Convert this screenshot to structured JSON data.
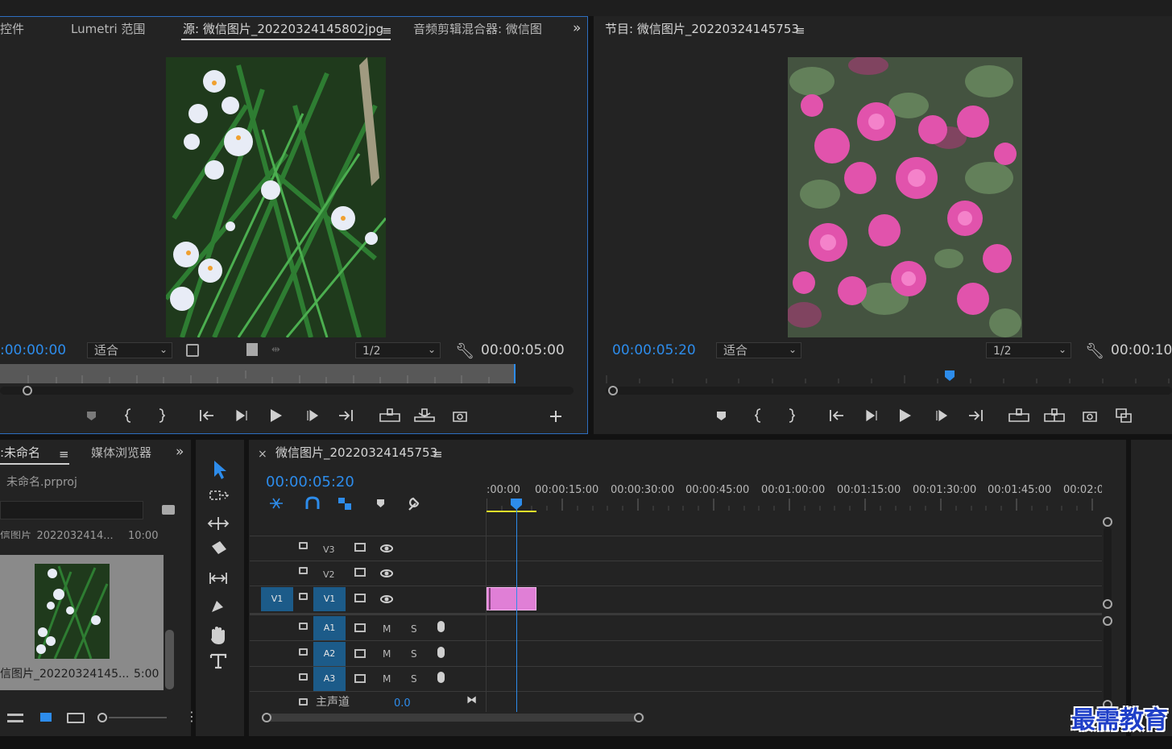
{
  "source_monitor": {
    "tabs": [
      "效果控件",
      "Lumetri 范围",
      "源: 微信图片_20220324145802jpg",
      "音频剪辑混合器: 微信图"
    ],
    "tab_left_partial": "控件",
    "active_tab": "源: 微信图片_20220324145802jpg",
    "menu_icon": "hamburger-icon",
    "overflow_icon": "double-chevron-icon",
    "timecode_current": "00:00:00",
    "fit_select": "适合",
    "resolution_select": "1/2",
    "timecode_duration": "00:00:05:00",
    "controls": [
      "marker",
      "in-point",
      "out-point",
      "go-to-in",
      "step-back",
      "play",
      "step-forward",
      "go-to-out",
      "insert",
      "overwrite",
      "export-frame",
      "add"
    ]
  },
  "program_monitor": {
    "title": "节目: 微信图片_20220324145753",
    "timecode_current": "00:00:05:20",
    "fit_select": "适合",
    "resolution_select": "1/2",
    "timecode_duration": "00:00:10:",
    "controls": [
      "marker",
      "in-point",
      "out-point",
      "go-to-in",
      "step-back",
      "play",
      "step-forward",
      "go-to-out",
      "lift",
      "extract",
      "export-frame",
      "compare"
    ]
  },
  "project_panel": {
    "tab_project": "目: 未命名",
    "tab_project_partial": ":未命名",
    "tab_media": "媒体浏览器",
    "tab_media_partial": "媒体浏览器",
    "file_name": "未命名.prproj",
    "item_top_name": "信图片_2022032414...",
    "item_top_duration": "10:00",
    "item_name": "信图片_20220324145...",
    "item_duration": "5:00"
  },
  "timeline": {
    "close": "×",
    "sequence_name": "微信图片_20220324145753",
    "timecode": "00:00:05:20",
    "ruler": [
      ":00:00",
      "00:00:15:00",
      "00:00:30:00",
      "00:00:45:00",
      "00:01:00:00",
      "00:01:15:00",
      "00:01:30:00",
      "00:01:45:00",
      "00:02:0"
    ],
    "video_tracks": [
      {
        "src": "",
        "name": "V3"
      },
      {
        "src": "",
        "name": "V2"
      },
      {
        "src": "V1",
        "name": "V1"
      }
    ],
    "audio_tracks": [
      {
        "name": "A1",
        "m": "M",
        "s": "S"
      },
      {
        "name": "A2",
        "m": "M",
        "s": "S"
      },
      {
        "name": "A3",
        "m": "M",
        "s": "S"
      }
    ],
    "master_label": "主声道",
    "master_value": "0.0",
    "clip_color": "#e07fd6"
  },
  "tools": [
    "selection-tool",
    "track-select-tool",
    "ripple-edit-tool",
    "razor-tool",
    "slip-tool",
    "pen-tool",
    "hand-tool",
    "type-tool"
  ],
  "watermark": "最需教育",
  "colors": {
    "accent": "#2d8ceb",
    "panel": "#232323",
    "bg": "#121212",
    "track_blue": "#1c5b89",
    "clip": "#e07fd6",
    "playhead": "#2d8ceb",
    "work_area": "#e8e82a"
  }
}
